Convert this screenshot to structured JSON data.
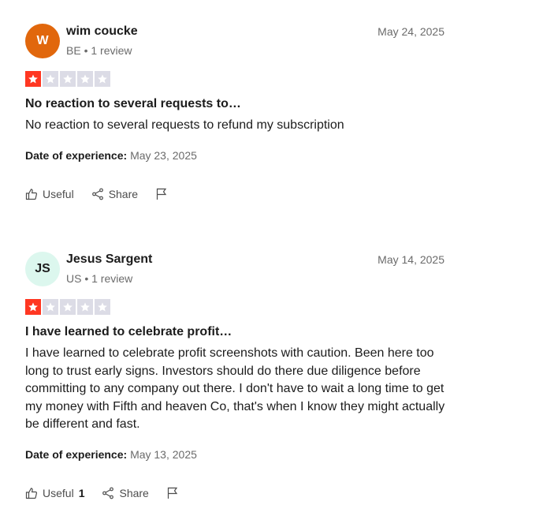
{
  "reviews": [
    {
      "initials": "W",
      "avatar_bg": "#e1670c",
      "avatar_fg": "#ffffff",
      "name": "wim coucke",
      "meta": "BE • 1 review",
      "date": "May 24, 2025",
      "rating": 1,
      "title": "No reaction to several requests to…",
      "body": "No reaction to several requests to refund my subscription",
      "exp_label": "Date of experience:",
      "exp_date": "May 23, 2025",
      "useful_label": "Useful",
      "useful_count": "",
      "share_label": "Share"
    },
    {
      "initials": "JS",
      "avatar_bg": "#dcf7ee",
      "avatar_fg": "#1c1c1c",
      "name": "Jesus Sargent",
      "meta": "US • 1 review",
      "date": "May 14, 2025",
      "rating": 1,
      "title": "I have learned to celebrate profit…",
      "body": "I have learned to celebrate profit screenshots with caution. Been here too long to trust early signs. Investors should do there due diligence before committing to any company out there. I don't have to wait a long time to get my money with Fifth and heaven Co, that's when I know they might actually be different and fast.",
      "exp_label": "Date of experience:",
      "exp_date": "May 13, 2025",
      "useful_label": "Useful",
      "useful_count": "1",
      "share_label": "Share"
    }
  ],
  "colors": {
    "star_on": "#ff3722",
    "star_off": "#dcdce6"
  }
}
